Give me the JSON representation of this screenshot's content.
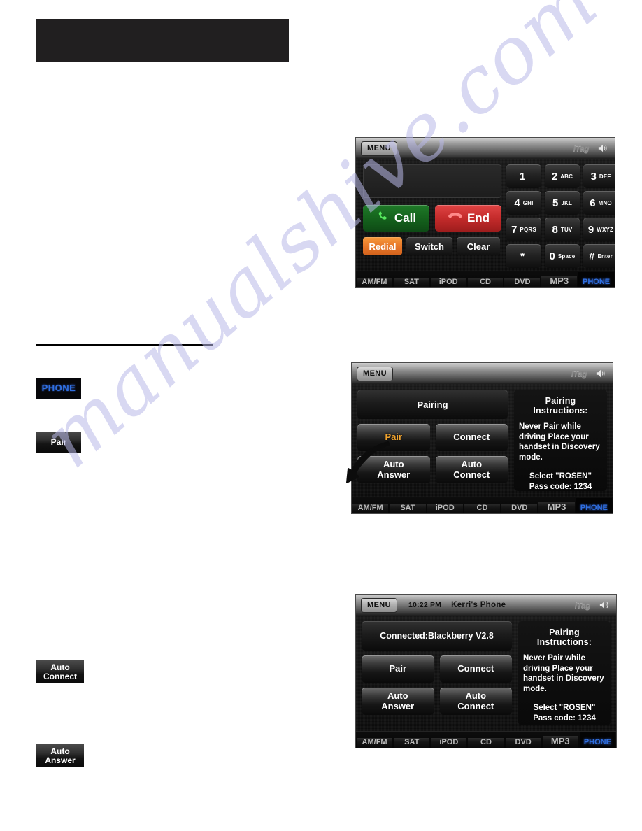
{
  "document": {
    "title_block": "",
    "watermark": "manualshive.com"
  },
  "inline_chips": [
    {
      "name": "phone",
      "label": "PHONE",
      "color": "#2f6fe0"
    },
    {
      "name": "pair",
      "label": "Pair"
    },
    {
      "name": "auto-connect",
      "line1": "Auto",
      "line2": "Connect"
    },
    {
      "name": "auto-answer",
      "line1": "Auto",
      "line2": "Answer"
    }
  ],
  "screens": {
    "dialpad": {
      "titlebar": {
        "menu": "MENU",
        "brand": "iTag",
        "speaker_icon": "speaker-icon"
      },
      "number_display": "",
      "call_button": {
        "label": "Call",
        "icon": "phone-handset-icon",
        "color": "#15631d"
      },
      "end_button": {
        "label": "End",
        "icon": "phone-hangup-icon",
        "color": "#c42b2b"
      },
      "action_buttons": [
        {
          "label": "Redial",
          "color": "#e8792a"
        },
        {
          "label": "Switch"
        },
        {
          "label": "Clear"
        }
      ],
      "keys": [
        {
          "digit": "1",
          "letters": ""
        },
        {
          "digit": "2",
          "letters": "ABC"
        },
        {
          "digit": "3",
          "letters": "DEF"
        },
        {
          "digit": "4",
          "letters": "GHI"
        },
        {
          "digit": "5",
          "letters": "JKL"
        },
        {
          "digit": "6",
          "letters": "MNO"
        },
        {
          "digit": "7",
          "letters": "PQRS"
        },
        {
          "digit": "8",
          "letters": "TUV"
        },
        {
          "digit": "9",
          "letters": "WXYZ"
        },
        {
          "digit": "*",
          "letters": ""
        },
        {
          "digit": "0",
          "letters": "Space"
        },
        {
          "digit": "#",
          "letters": "Enter"
        }
      ],
      "sources": [
        {
          "label": "AM/FM",
          "active": false,
          "emphasis": false
        },
        {
          "label": "SAT",
          "active": false,
          "emphasis": false
        },
        {
          "label": "iPOD",
          "active": false,
          "emphasis": false
        },
        {
          "label": "CD",
          "active": false,
          "emphasis": false
        },
        {
          "label": "DVD",
          "active": false,
          "emphasis": false
        },
        {
          "label": "MP3",
          "active": false,
          "emphasis": true
        },
        {
          "label": "PHONE",
          "active": true,
          "emphasis": false
        }
      ]
    },
    "pairing": {
      "titlebar": {
        "menu": "MENU",
        "brand": "iTag",
        "speaker_icon": "speaker-icon"
      },
      "status": "Pairing",
      "buttons": [
        {
          "label": "Pair",
          "highlighted": true
        },
        {
          "label": "Connect",
          "highlighted": false
        },
        {
          "line1": "Auto",
          "line2": "Answer",
          "highlighted": false
        },
        {
          "line1": "Auto",
          "line2": "Connect",
          "highlighted": false
        }
      ],
      "instructions": {
        "heading": "Pairing Instructions:",
        "body": "Never Pair while driving Place your handset in Discovery mode.",
        "select": "Select \"ROSEN\"",
        "passcode": "Pass code: 1234"
      },
      "sources": [
        {
          "label": "AM/FM",
          "active": false,
          "emphasis": false
        },
        {
          "label": "SAT",
          "active": false,
          "emphasis": false
        },
        {
          "label": "iPOD",
          "active": false,
          "emphasis": false
        },
        {
          "label": "CD",
          "active": false,
          "emphasis": false
        },
        {
          "label": "DVD",
          "active": false,
          "emphasis": false
        },
        {
          "label": "MP3",
          "active": false,
          "emphasis": true
        },
        {
          "label": "PHONE",
          "active": true,
          "emphasis": false
        }
      ],
      "annotation": "callout-arrow-icon"
    },
    "connected": {
      "titlebar": {
        "menu": "MENU",
        "time": "10:22 PM",
        "device_name": "Kerri's Phone",
        "brand": "iTag",
        "speaker_icon": "speaker-icon"
      },
      "status": "Connected:Blackberry V2.8",
      "buttons": [
        {
          "label": "Pair",
          "highlighted": false
        },
        {
          "label": "Connect",
          "highlighted": false
        },
        {
          "line1": "Auto",
          "line2": "Answer",
          "highlighted": false
        },
        {
          "line1": "Auto",
          "line2": "Connect",
          "highlighted": false
        }
      ],
      "instructions": {
        "heading": "Pairing Instructions:",
        "body": "Never Pair while driving Place your handset in Discovery mode.",
        "select": "Select \"ROSEN\"",
        "passcode": "Pass code: 1234"
      },
      "sources": [
        {
          "label": "AM/FM",
          "active": false,
          "emphasis": false
        },
        {
          "label": "SAT",
          "active": false,
          "emphasis": false
        },
        {
          "label": "iPOD",
          "active": false,
          "emphasis": false
        },
        {
          "label": "CD",
          "active": false,
          "emphasis": false
        },
        {
          "label": "DVD",
          "active": false,
          "emphasis": false
        },
        {
          "label": "MP3",
          "active": false,
          "emphasis": true
        },
        {
          "label": "PHONE",
          "active": true,
          "emphasis": false
        }
      ]
    }
  }
}
